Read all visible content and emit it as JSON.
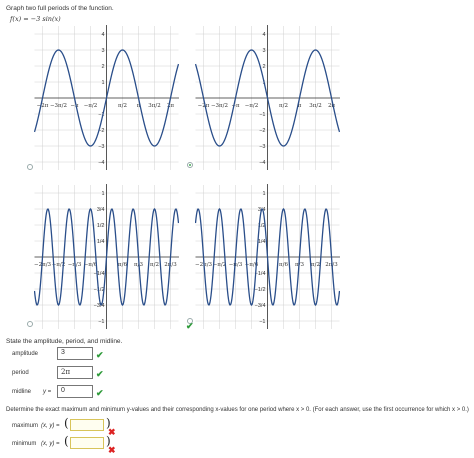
{
  "instructions": {
    "graph_prompt": "Graph two full periods of the function.",
    "function": "f(x) = −3 sin(x)"
  },
  "graphs": [
    {
      "x_ticks": [
        "−2π",
        "−3π/2",
        "−π",
        "−π/2",
        "π/2",
        "π",
        "3π/2",
        "2π"
      ],
      "y_ticks": [
        "4",
        "3",
        "2",
        "1",
        "−1",
        "−2",
        "−3",
        "−4"
      ],
      "selected": false
    },
    {
      "x_ticks": [
        "−2π",
        "−3π/2",
        "−π",
        "−π/2",
        "π/2",
        "π",
        "3π/2",
        "2π"
      ],
      "y_ticks": [
        "4",
        "3",
        "2",
        "1",
        "−1",
        "−2",
        "−3",
        "−4"
      ],
      "selected": true
    },
    {
      "x_ticks": [
        "−2π/3",
        "−π/2",
        "−π/3",
        "−π/6",
        "π/6",
        "π/3",
        "π/2",
        "2π/3"
      ],
      "y_ticks": [
        "1",
        "3/4",
        "1/2",
        "1/4",
        "−1/4",
        "−1/2",
        "−3/4",
        "−1"
      ],
      "selected": false,
      "correct": true
    },
    {
      "x_ticks": [
        "−2π/3",
        "−π/2",
        "−π/3",
        "−π/6",
        "π/6",
        "π/3",
        "π/2",
        "2π/3"
      ],
      "y_ticks": [
        "1",
        "3/4",
        "1/2",
        "1/4",
        "−1/4",
        "−1/2",
        "−3/4",
        "−1"
      ],
      "selected": false,
      "correct": true
    }
  ],
  "axis_labels": {
    "x": "x",
    "y": "y"
  },
  "part2": {
    "prompt": "State the amplitude, period, and midline.",
    "amplitude_label": "amplitude",
    "amplitude_value": "3",
    "period_label": "period",
    "period_value": "2π",
    "midline_label": "midline",
    "midline_prefix": "y =",
    "midline_value": "0"
  },
  "part3": {
    "prompt": "Determine the exact maximum and minimum y-values and their corresponding x-values for one period where x > 0. (For each answer, use the first occurrence for which x > 0.)",
    "maximum_label": "maximum",
    "maximum_prefix": "(x, y) =",
    "maximum_value": "",
    "minimum_label": "minimum",
    "minimum_prefix": "(x, y) =",
    "minimum_value": ""
  },
  "icons": {
    "check": "✔",
    "cross": "✖"
  },
  "colors": {
    "curve": "#2a4e8a",
    "grid": "#d0d0d0",
    "check": "#2e9b3a",
    "cross": "#dd2222"
  }
}
